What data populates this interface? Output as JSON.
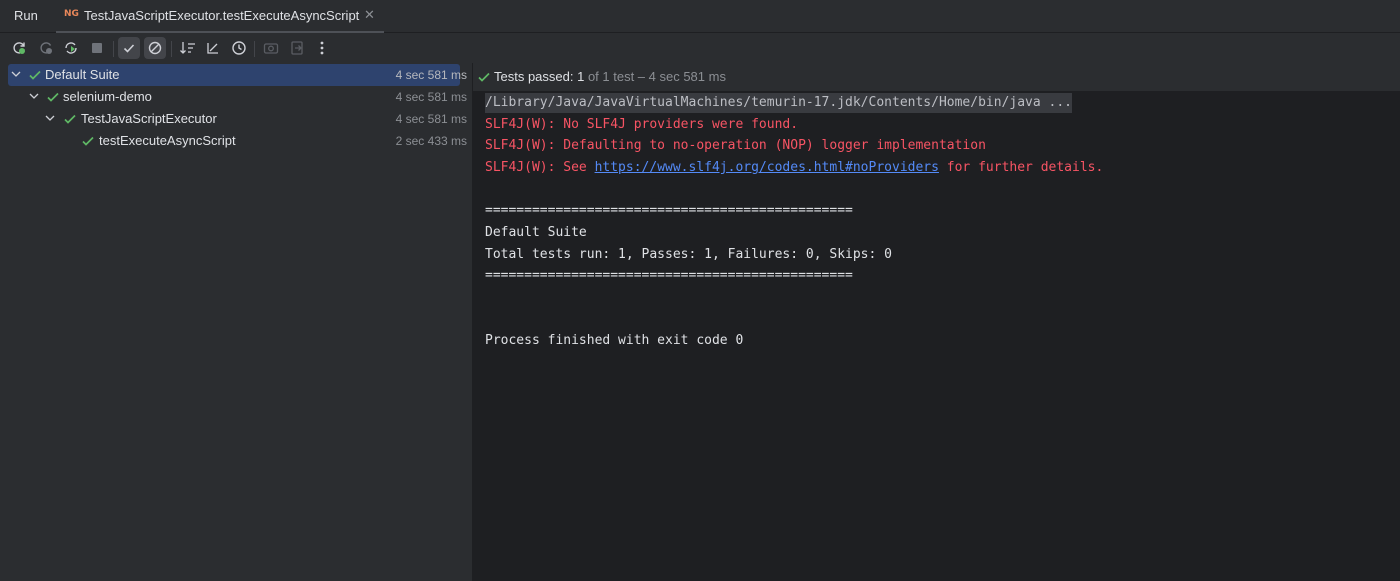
{
  "tabbar": {
    "run_label": "Run",
    "tab_icon_text": "NG",
    "tab_title": "TestJavaScriptExecutor.testExecuteAsyncScript",
    "close_glyph": "✕"
  },
  "toolbar": {
    "buttons": [
      "rerun-icon",
      "rerun-failed-icon",
      "toggle-auto-test-icon",
      "stop-icon",
      "show-passed-icon",
      "show-ignored-icon",
      "sort-alphabetically-icon",
      "sort-by-duration-icon",
      "history-icon",
      "screenshot-icon",
      "export-icon",
      "more-icon"
    ]
  },
  "tree": [
    {
      "label": "Default Suite",
      "time": "4 sec 581 ms",
      "depth": 0,
      "selected": true
    },
    {
      "label": "selenium-demo",
      "time": "4 sec 581 ms",
      "depth": 1,
      "selected": false
    },
    {
      "label": "TestJavaScriptExecutor",
      "time": "4 sec 581 ms",
      "depth": 2,
      "selected": false
    },
    {
      "label": "testExecuteAsyncScript",
      "time": "2 sec 433 ms",
      "depth": 3,
      "selected": false
    }
  ],
  "status": {
    "passed": "Tests passed: 1",
    "detail": " of 1 test – 4 sec 581 ms"
  },
  "console": {
    "command": "/Library/Java/JavaVirtualMachines/temurin-17.jdk/Contents/Home/bin/java ...",
    "err1": "SLF4J(W): No SLF4J providers were found.",
    "err2": "SLF4J(W): Defaulting to no-operation (NOP) logger implementation",
    "err3_prefix": "SLF4J(W): See ",
    "err3_link": "https://www.slf4j.org/codes.html#noProviders",
    "err3_suffix": " for further details.",
    "sep1": "===============================================",
    "suite": "Default Suite",
    "totals": "Total tests run: 1, Passes: 1, Failures: 0, Skips: 0",
    "sep2": "===============================================",
    "finished": "Process finished with exit code 0"
  },
  "colors": {
    "accent_pass": "#5fb865",
    "error_text": "#f75464",
    "link": "#548af7",
    "selection": "#2e436e"
  }
}
